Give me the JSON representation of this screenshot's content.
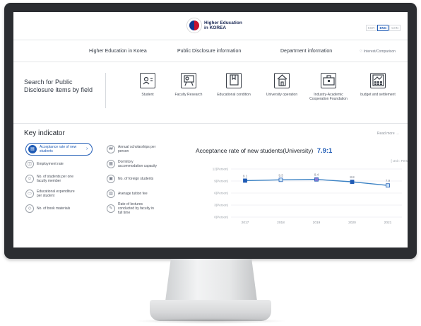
{
  "header": {
    "logo_line1": "Higher Education",
    "logo_line2": "in KOREA",
    "languages": [
      "KOR",
      "ENG",
      "CHN"
    ],
    "active_language": "ENG"
  },
  "nav": {
    "items": [
      "Higher Education in Korea",
      "Public Disclosure information",
      "Department information"
    ],
    "interest": "Interest/Comparison"
  },
  "field_search": {
    "title": "Search for Public Disclosure items by field",
    "categories": [
      {
        "label": "Student",
        "icon": "student-icon"
      },
      {
        "label": "Faculty Research",
        "icon": "faculty-research-icon"
      },
      {
        "label": "Educational condition",
        "icon": "educational-condition-icon"
      },
      {
        "label": "University operation",
        "icon": "university-operation-icon"
      },
      {
        "label": "Industry-Academic Cooperation Foundation",
        "icon": "industry-cooperation-icon"
      },
      {
        "label": "budget and settlement",
        "icon": "budget-settlement-icon"
      }
    ]
  },
  "key_indicator": {
    "title": "Key indicator",
    "read_more": "Read more",
    "indicators": [
      {
        "label": "Acceptance rate of new students",
        "active": true,
        "icon": "acceptance-icon"
      },
      {
        "label": "Annual scholarships per person",
        "active": false,
        "icon": "scholarship-icon"
      },
      {
        "label": "Employment rate",
        "active": false,
        "icon": "employment-icon"
      },
      {
        "label": "Dormitory accommodation capacity",
        "active": false,
        "icon": "dormitory-icon"
      },
      {
        "label": "No. of students per one faculty member",
        "active": false,
        "icon": "faculty-ratio-icon"
      },
      {
        "label": "No. of foreign students",
        "active": false,
        "icon": "foreign-students-icon"
      },
      {
        "label": "Educational expenditure per student",
        "active": false,
        "icon": "expenditure-icon"
      },
      {
        "label": "Average tuition fee",
        "active": false,
        "icon": "tuition-icon"
      },
      {
        "label": "No. of book materials",
        "active": false,
        "icon": "book-icon"
      },
      {
        "label": "Rate of lectures conducted by faculty in full time",
        "active": false,
        "icon": "lecture-icon"
      }
    ]
  },
  "chart_panel": {
    "title": "Acceptance rate of new students(University)",
    "ratio": "7.9:1",
    "unit": "[ Unit : Pers"
  },
  "chart_data": {
    "type": "line",
    "x": [
      "2017",
      "2018",
      "2019",
      "2020",
      "2021"
    ],
    "values": [
      9.1,
      9.3,
      9.4,
      8.8,
      7.9
    ],
    "value_labels": [
      "9.1",
      "9.3",
      "9.4",
      "8.8",
      "7.9"
    ],
    "y_ticks": [
      "12(Person)",
      "9(Person)",
      "6(Person)",
      "3(Person)",
      "0(Person)"
    ],
    "ylim": [
      0,
      12
    ],
    "grid": true,
    "colors": {
      "line": "#3b82c4",
      "point": "#1f5bb5",
      "highlight": "#8b7bd8"
    }
  }
}
